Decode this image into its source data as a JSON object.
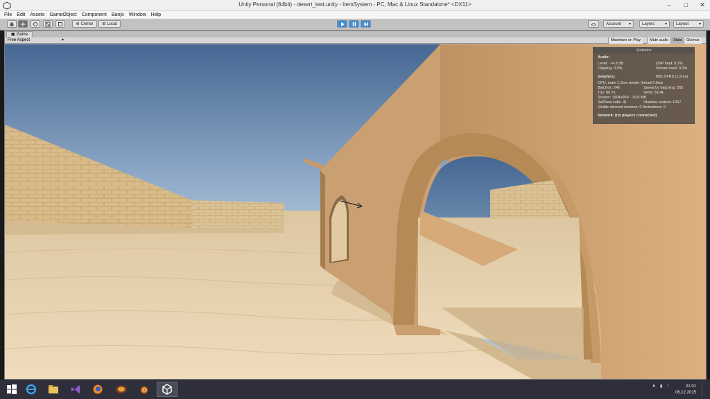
{
  "window": {
    "title": "Unity Personal (64bit) - desert_test.unity - ItemSystem - PC, Mac & Linux Standalone* <DX11>",
    "min_glyph": "–",
    "max_glyph": "□",
    "close_glyph": "✕"
  },
  "menu": [
    "File",
    "Edit",
    "Assets",
    "GameObject",
    "Component",
    "Banjo",
    "Window",
    "Help"
  ],
  "toolbar": {
    "center_label": "Center",
    "local_label": "Local",
    "account_label": "Account",
    "layers_label": "Layers",
    "layout_label": "Layout",
    "dropdown_glyph": "▾"
  },
  "game": {
    "tab_label": "Game",
    "aspect_label": "Free Aspect",
    "maximize_label": "Maximize on Play",
    "mute_label": "Mute audio",
    "stats_label": "Stats",
    "gizmos_label": "Gizmos"
  },
  "statistics": {
    "title": "Statistics",
    "audio_header": "Audio:",
    "level": "Level: -74.8 dB",
    "dsp_load": "DSP load: 0.2%",
    "clipping": "Clipping: 0.0%",
    "stream_load": "Stream load: 0.0%",
    "graphics_header": "Graphics:",
    "fps": "650.3 FPS (1.5ms)",
    "cpu": "CPU: main 1.3ms  render thread 0.9ms",
    "batches": "Batches: 246",
    "saved_batching": "Saved by batching: 202",
    "tris": "Tris: 86.7k",
    "verts": "Verts: 59.4k",
    "screen": "Screen: 1904x909 - 19.8 MB",
    "setpass": "SetPass calls: 41",
    "shadow_casters": "Shadow casters: 1057",
    "skinned": "Visible skinned meshes: 0  Animations: 0",
    "network": "Network: (no players connected)"
  },
  "taskbar": {
    "time": "01:01",
    "date": "06.12.2015"
  },
  "colors": {
    "sky_top": "#4b6d96",
    "sky_bottom": "#a9bfd3",
    "sand": "#e6cfa8",
    "wall": "#d2a673",
    "play_blue": "#3d8fd8"
  }
}
